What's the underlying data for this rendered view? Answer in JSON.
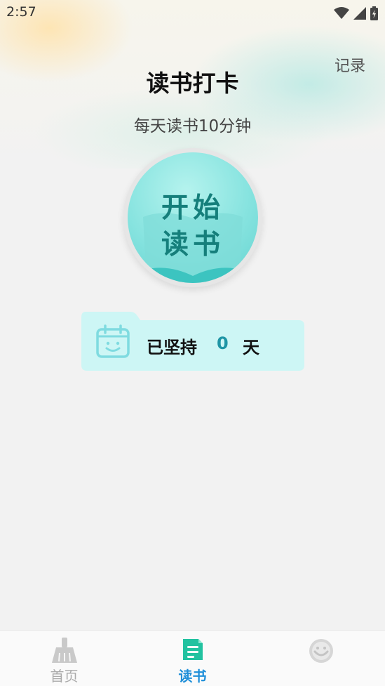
{
  "status_bar": {
    "time": "2:57"
  },
  "header": {
    "title": "读书打卡",
    "records_label": "记录",
    "subtitle": "每天读书10分钟"
  },
  "start_button": {
    "line1": "开始",
    "line2": "读书"
  },
  "streak": {
    "prefix": "已坚持",
    "count": "0",
    "suffix": "天"
  },
  "bottom_nav": {
    "items": [
      {
        "label": "首页",
        "icon": "broom-icon",
        "active": false
      },
      {
        "label": "读书",
        "icon": "book-icon",
        "active": true
      },
      {
        "label": "",
        "icon": "profile-icon",
        "active": false
      }
    ]
  },
  "colors": {
    "accent_teal": "#1e95a5",
    "nav_active": "#1f8fd9",
    "button_teal": "#86e3df",
    "card_bg": "#cdf6f5"
  }
}
